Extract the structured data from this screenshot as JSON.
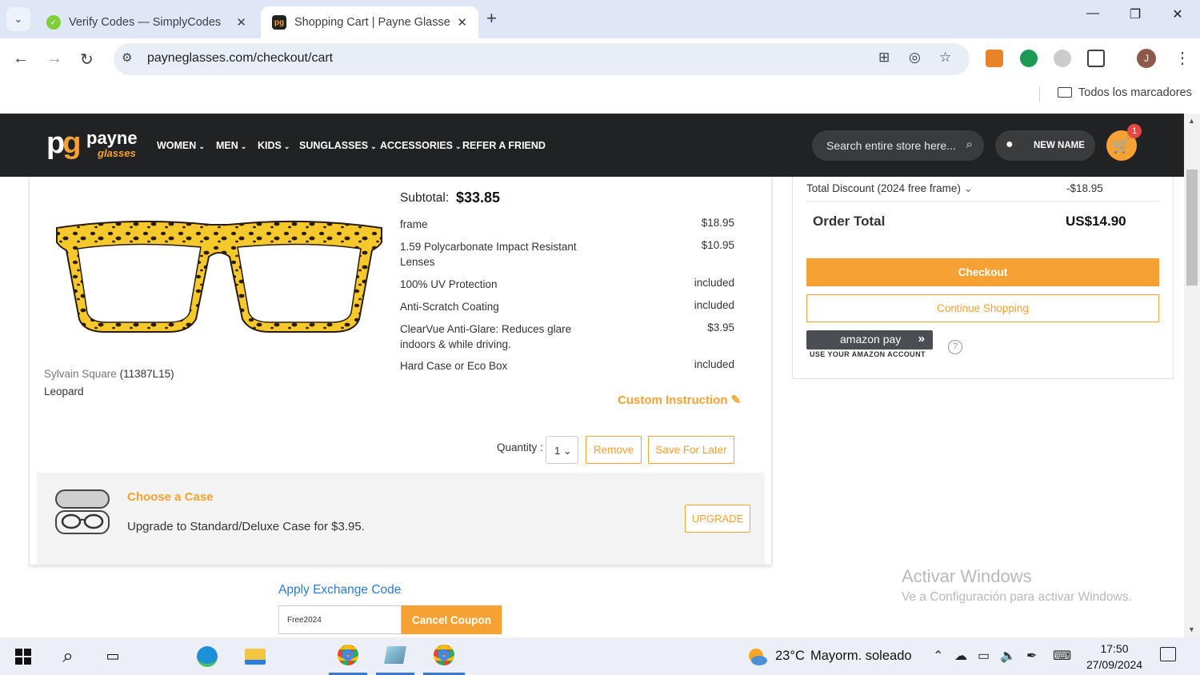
{
  "browser": {
    "tabs": [
      {
        "title": "Verify Codes — SimplyCodes",
        "close": "✕"
      },
      {
        "title": "Shopping Cart | Payne Glasses",
        "close": "✕"
      }
    ],
    "new_tab": "+",
    "url": "payneglasses.com/checkout/cart",
    "bookmarks_folder": "Todos los marcadores",
    "profile_initial": "J"
  },
  "site": {
    "logo_mark": "pg",
    "logo_name": "payne",
    "logo_sub": "glasses",
    "menu": [
      "WOMEN",
      "MEN",
      "KIDS",
      "SUNGLASSES",
      "ACCESSORIES",
      "REFER A FRIEND"
    ],
    "search_placeholder": "Search entire store here...",
    "user_name": "NEW NAME",
    "cart_count": "1"
  },
  "cart_item": {
    "name": "Sylvain Square",
    "sku": "(11387L15)",
    "color": "Leopard",
    "subtotal_label": "Subtotal:",
    "subtotal": "$33.85",
    "options": [
      {
        "label": "frame",
        "value": "$18.95"
      },
      {
        "label": "1.59 Polycarbonate Impact Resistant Lenses",
        "value": "$10.95"
      },
      {
        "label": "100% UV Protection",
        "value": "included"
      },
      {
        "label": "Anti-Scratch Coating",
        "value": "included"
      },
      {
        "label": "ClearVue Anti-Glare: Reduces glare indoors & while driving.",
        "value": "$3.95"
      },
      {
        "label": "Hard Case or Eco Box",
        "value": "included"
      }
    ],
    "custom_instruction": "Custom Instruction",
    "quantity_label": "Quantity :",
    "quantity": "1",
    "remove": "Remove",
    "save_for_later": "Save For Later"
  },
  "case_upsell": {
    "title": "Choose a Case",
    "description": "Upgrade to Standard/Deluxe Case for $3.95.",
    "button": "UPGRADE"
  },
  "coupon": {
    "link": "Apply Exchange Code",
    "value": "Free2024",
    "button": "Cancel Coupon"
  },
  "summary": {
    "discount_label": "Total Discount (2024 free frame)",
    "discount_value": "-$18.95",
    "total_label": "Order Total",
    "total_value": "US$14.90",
    "checkout": "Checkout",
    "continue": "Continue Shopping",
    "amazon_pay": "amazon pay",
    "amazon_sub": "USE YOUR AMAZON ACCOUNT",
    "help": "?"
  },
  "watermark": {
    "title": "Activar Windows",
    "subtitle": "Ve a Configuración para activar Windows."
  },
  "taskbar": {
    "temperature": "23°C",
    "condition": "Mayorm. soleado",
    "time": "17:50",
    "date": "27/09/2024"
  },
  "colors": {
    "accent": "#f6a133",
    "header_bg": "#212223",
    "link": "#2d7bd1"
  }
}
